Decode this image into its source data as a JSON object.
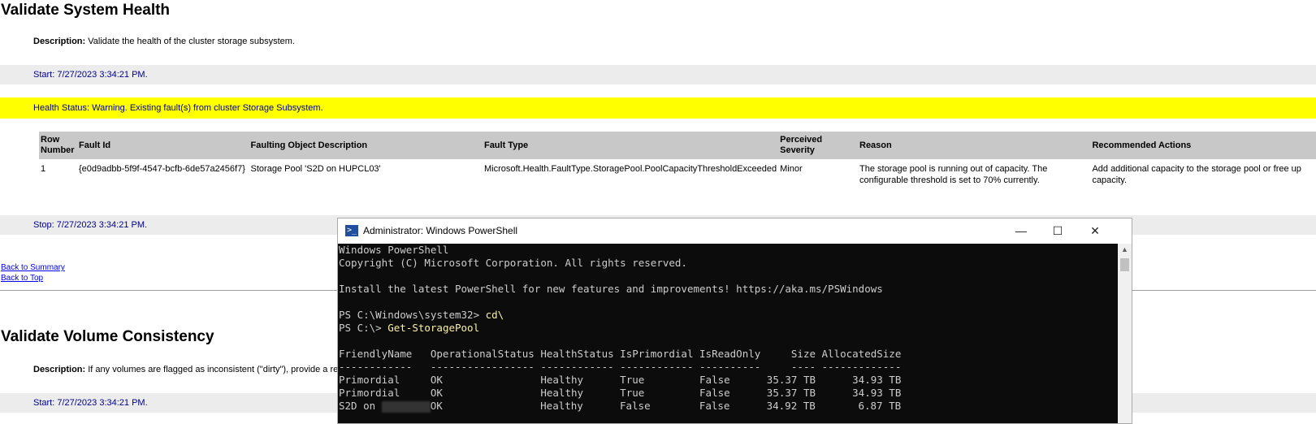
{
  "section1": {
    "title": "Validate System Health",
    "desc_label": "Description:",
    "desc_text": "Validate the health of the cluster storage subsystem.",
    "start": "Start: 7/27/2023 3:34:21 PM.",
    "health_status": "Health Status: Warning. Existing fault(s) from cluster Storage Subsystem.",
    "table": {
      "headers": [
        "Row Number",
        "Fault Id",
        "Faulting Object Description",
        "Fault Type",
        "Perceived Severity",
        "Reason",
        "Recommended Actions"
      ],
      "rows": [
        [
          "1",
          "{e0d9adbb-5f9f-4547-bcfb-6de57a2456f7}",
          "Storage Pool 'S2D on HUPCL03'",
          "Microsoft.Health.FaultType.StoragePool.PoolCapacityThresholdExceeded",
          "Minor",
          "The storage pool is running out of capacity. The configurable threshold is set to 70% currently.",
          "Add additional capacity to the storage pool or free up capacity."
        ]
      ]
    },
    "stop": "Stop: 7/27/2023 3:34:21 PM.",
    "back_summary": "Back to Summary",
    "back_top": "Back to Top"
  },
  "section2": {
    "title": "Validate Volume Consistency",
    "desc_label": "Description:",
    "desc_text": "If any volumes are flagged as inconsistent (\"dirty\"), provide a re",
    "start": "Start: 7/27/2023 3:34:21 PM."
  },
  "powershell": {
    "title": "Administrator: Windows PowerShell",
    "icon": "powershell-icon",
    "minimize": "—",
    "maximize": "☐",
    "close": "✕",
    "lines": {
      "l1": "Windows PowerShell",
      "l2": "Copyright (C) Microsoft Corporation. All rights reserved.",
      "l3": "Install the latest PowerShell for new features and improvements! https://aka.ms/PSWindows",
      "p1": "PS C:\\Windows\\system32> ",
      "c1": "cd\\",
      "p2": "PS C:\\> ",
      "c2": "Get-StoragePool",
      "hdr": "FriendlyName   OperationalStatus HealthStatus IsPrimordial IsReadOnly     Size AllocatedSize",
      "sep": "------------   ----------------- ------------ ------------ ----------     ---- -------------",
      "r1": "Primordial     OK                Healthy      True         False      35.37 TB      34.93 TB",
      "r2": "Primordial     OK                Healthy      True         False      35.37 TB      34.93 TB",
      "r3a": "S2D on ",
      "r3b": "OK                Healthy      False        False      34.92 TB       6.87 TB"
    }
  },
  "colors": {
    "warning_bg": "#ffff00",
    "status_text": "#00008b",
    "band_bg": "#ececec",
    "console_bg": "#0c0c0c",
    "command": "#f9f1a5"
  }
}
